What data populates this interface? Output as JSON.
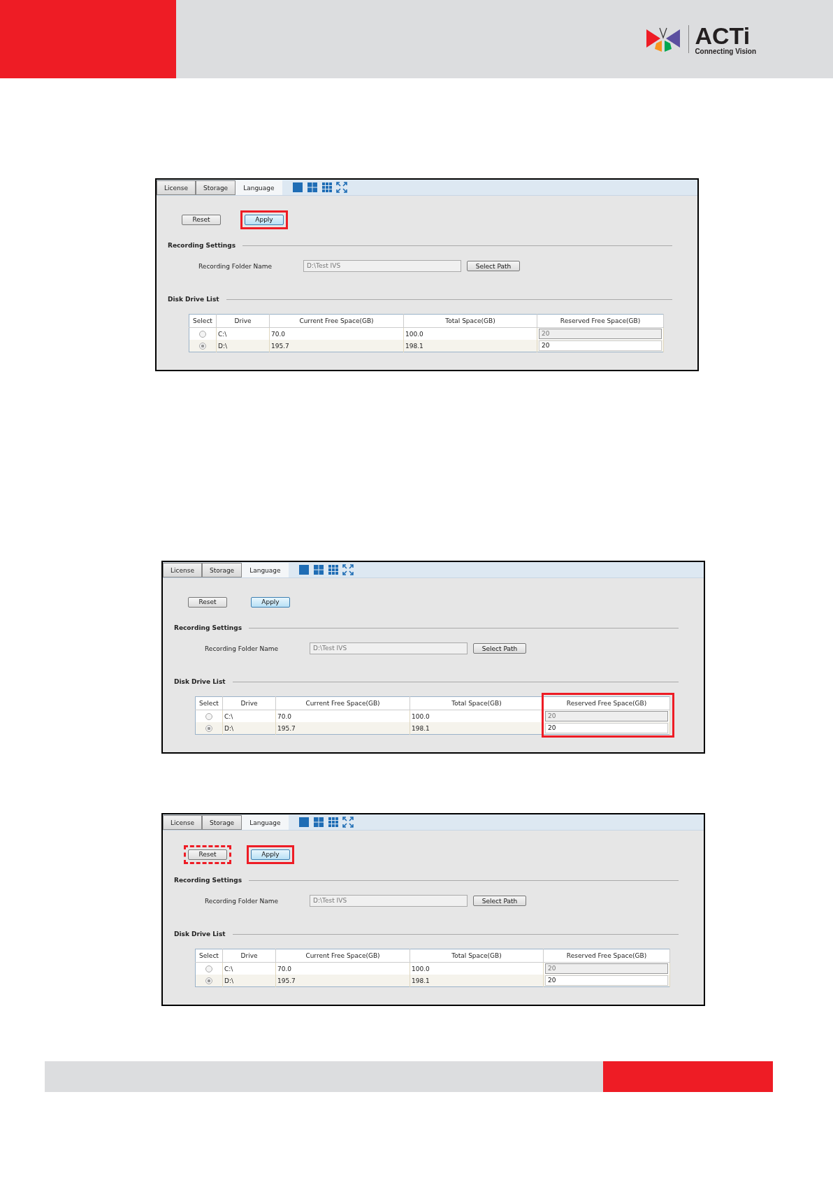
{
  "header": {
    "logo": {
      "name": "ACTi",
      "tagline": "Connecting Vision"
    }
  },
  "screenshots": [
    {
      "tabs": [
        {
          "label": "License",
          "selected": false
        },
        {
          "label": "Storage",
          "selected": false
        },
        {
          "label": "Language",
          "selected": true
        }
      ],
      "buttons": [
        {
          "label": "Reset",
          "outlined": false
        },
        {
          "label": "Apply",
          "outlined": true,
          "dashed": false
        }
      ],
      "recording_settings": {
        "title": "Recording Settings",
        "label": "Recording Folder Name",
        "value": "D:\\Test IVS",
        "button": "Select Path"
      },
      "disk_drive_list": {
        "title": "Disk Drive List",
        "reserved_column_outlined": false,
        "columns": [
          "Select",
          "Drive",
          "Current Free Space(GB)",
          "Total Space(GB)",
          "Reserved Free Space(GB)"
        ],
        "rows": [
          {
            "selected": false,
            "drive": "C:\\",
            "free": "70.0",
            "total": "100.0",
            "reserved": "20",
            "disabled": true
          },
          {
            "selected": true,
            "drive": "D:\\",
            "free": "195.7",
            "total": "198.1",
            "reserved": "20",
            "disabled": false
          }
        ]
      }
    },
    {
      "tabs": [
        {
          "label": "License",
          "selected": false
        },
        {
          "label": "Storage",
          "selected": false
        },
        {
          "label": "Language",
          "selected": true
        }
      ],
      "buttons": [
        {
          "label": "Reset",
          "outlined": false
        },
        {
          "label": "Apply",
          "outlined": false
        }
      ],
      "recording_settings": {
        "title": "Recording Settings",
        "label": "Recording Folder Name",
        "value": "D:\\Test IVS",
        "button": "Select Path"
      },
      "disk_drive_list": {
        "title": "Disk Drive List",
        "reserved_column_outlined": true,
        "columns": [
          "Select",
          "Drive",
          "Current Free Space(GB)",
          "Total Space(GB)",
          "Reserved Free Space(GB)"
        ],
        "rows": [
          {
            "selected": false,
            "drive": "C:\\",
            "free": "70.0",
            "total": "100.0",
            "reserved": "20",
            "disabled": true
          },
          {
            "selected": true,
            "drive": "D:\\",
            "free": "195.7",
            "total": "198.1",
            "reserved": "20",
            "disabled": false
          }
        ]
      }
    },
    {
      "tabs": [
        {
          "label": "License",
          "selected": false
        },
        {
          "label": "Storage",
          "selected": false
        },
        {
          "label": "Language",
          "selected": true
        }
      ],
      "buttons": [
        {
          "label": "Reset",
          "outlined": true,
          "dashed": true
        },
        {
          "label": "Apply",
          "outlined": true,
          "dashed": false
        }
      ],
      "recording_settings": {
        "title": "Recording Settings",
        "label": "Recording Folder Name",
        "value": "D:\\Test IVS",
        "button": "Select Path"
      },
      "disk_drive_list": {
        "title": "Disk Drive List",
        "reserved_column_outlined": false,
        "columns": [
          "Select",
          "Drive",
          "Current Free Space(GB)",
          "Total Space(GB)",
          "Reserved Free Space(GB)"
        ],
        "rows": [
          {
            "selected": false,
            "drive": "C:\\",
            "free": "70.0",
            "total": "100.0",
            "reserved": "20",
            "disabled": true
          },
          {
            "selected": true,
            "drive": "D:\\",
            "free": "195.7",
            "total": "198.1",
            "reserved": "20",
            "disabled": false
          }
        ]
      }
    }
  ]
}
